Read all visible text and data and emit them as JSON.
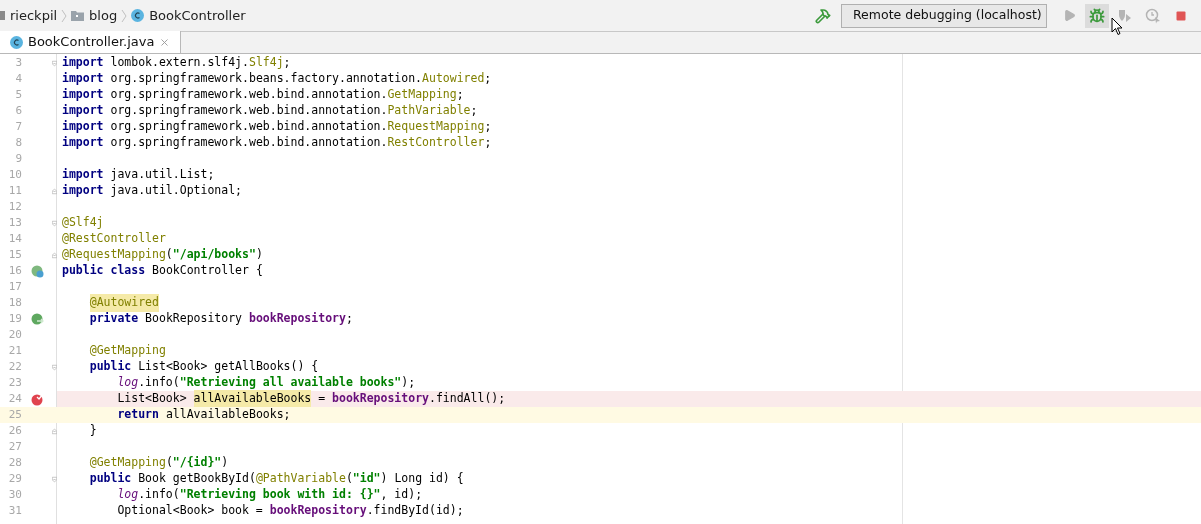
{
  "breadcrumbs": [
    {
      "label": "rieckpil",
      "kind": "module"
    },
    {
      "label": "blog",
      "kind": "folder"
    },
    {
      "label": "BookController",
      "kind": "class"
    }
  ],
  "toolbar": {
    "run_config": "Remote debugging (localhost)",
    "buttons": [
      {
        "kind": "run",
        "disabled": true,
        "hovered": false
      },
      {
        "kind": "debug",
        "disabled": false,
        "hovered": true
      },
      {
        "kind": "coverage",
        "disabled": true,
        "hovered": false
      },
      {
        "kind": "profile",
        "disabled": true,
        "hovered": false
      },
      {
        "kind": "stop",
        "disabled": false,
        "hovered": false
      }
    ]
  },
  "tabs": [
    {
      "label": "BookController.java",
      "selected": true
    }
  ],
  "lines": [
    {
      "n": "3",
      "fold": {
        "kind": "start"
      },
      "tokens": [
        {
          "kind": "kw",
          "text": "import"
        },
        {
          "kind": "plain",
          "text": " lombok.extern.slf4j."
        },
        {
          "kind": "ann",
          "text": "Slf4j"
        },
        {
          "kind": "plain",
          "text": ";"
        }
      ]
    },
    {
      "n": "4",
      "tokens": [
        {
          "kind": "kw",
          "text": "import"
        },
        {
          "kind": "plain",
          "text": " org.springframework.beans.factory.annotation."
        },
        {
          "kind": "ann",
          "text": "Autowired"
        },
        {
          "kind": "plain",
          "text": ";"
        }
      ]
    },
    {
      "n": "5",
      "tokens": [
        {
          "kind": "kw",
          "text": "import"
        },
        {
          "kind": "plain",
          "text": " org.springframework.web.bind.annotation."
        },
        {
          "kind": "ann",
          "text": "GetMapping"
        },
        {
          "kind": "plain",
          "text": ";"
        }
      ]
    },
    {
      "n": "6",
      "tokens": [
        {
          "kind": "kw",
          "text": "import"
        },
        {
          "kind": "plain",
          "text": " org.springframework.web.bind.annotation."
        },
        {
          "kind": "ann",
          "text": "PathVariable"
        },
        {
          "kind": "plain",
          "text": ";"
        }
      ]
    },
    {
      "n": "7",
      "tokens": [
        {
          "kind": "kw",
          "text": "import"
        },
        {
          "kind": "plain",
          "text": " org.springframework.web.bind.annotation."
        },
        {
          "kind": "ann",
          "text": "RequestMapping"
        },
        {
          "kind": "plain",
          "text": ";"
        }
      ]
    },
    {
      "n": "8",
      "tokens": [
        {
          "kind": "kw",
          "text": "import"
        },
        {
          "kind": "plain",
          "text": " org.springframework.web.bind.annotation."
        },
        {
          "kind": "ann",
          "text": "RestController"
        },
        {
          "kind": "plain",
          "text": ";"
        }
      ]
    },
    {
      "n": "9"
    },
    {
      "n": "10",
      "tokens": [
        {
          "kind": "kw",
          "text": "import"
        },
        {
          "kind": "plain",
          "text": " java.util.List;"
        }
      ]
    },
    {
      "n": "11",
      "fold": {
        "kind": "end"
      },
      "tokens": [
        {
          "kind": "kw",
          "text": "import"
        },
        {
          "kind": "plain",
          "text": " java.util.Optional;"
        }
      ]
    },
    {
      "n": "12"
    },
    {
      "n": "13",
      "fold": {
        "kind": "start"
      },
      "tokens": [
        {
          "kind": "ann",
          "text": "@Slf4j"
        }
      ]
    },
    {
      "n": "14",
      "tokens": [
        {
          "kind": "ann",
          "text": "@RestController"
        }
      ]
    },
    {
      "n": "15",
      "fold": {
        "kind": "end"
      },
      "tokens": [
        {
          "kind": "ann",
          "text": "@RequestMapping"
        },
        {
          "kind": "plain",
          "text": "("
        },
        {
          "kind": "str",
          "text": "\"/api/books\""
        },
        {
          "kind": "plain",
          "text": ")"
        }
      ]
    },
    {
      "n": "16",
      "gutter_icon": {
        "kind": "bean"
      },
      "tokens": [
        {
          "kind": "kw",
          "text": "public class"
        },
        {
          "kind": "plain",
          "text": " BookController {"
        }
      ]
    },
    {
      "n": "17"
    },
    {
      "n": "18",
      "tokens": [
        {
          "kind": "annhl",
          "text": "    @Autowired"
        }
      ]
    },
    {
      "n": "19",
      "gutter_icon": {
        "kind": "autowired"
      },
      "tokens": [
        {
          "kind": "kw",
          "text": "    private"
        },
        {
          "kind": "plain",
          "text": " BookRepository "
        },
        {
          "kind": "field",
          "text": "bookRepository"
        },
        {
          "kind": "plain",
          "text": ";"
        }
      ]
    },
    {
      "n": "20"
    },
    {
      "n": "21",
      "tokens": [
        {
          "kind": "ann",
          "text": "    @GetMapping"
        }
      ]
    },
    {
      "n": "22",
      "fold": {
        "kind": "start"
      },
      "tokens": [
        {
          "kind": "kw",
          "text": "    public"
        },
        {
          "kind": "plain",
          "text": " List<Book> getAllBooks() {"
        }
      ]
    },
    {
      "n": "23",
      "tokens": [
        {
          "kind": "log",
          "text": "        log"
        },
        {
          "kind": "plain",
          "text": ".info("
        },
        {
          "kind": "str",
          "text": "\"Retrieving all available books\""
        },
        {
          "kind": "plain",
          "text": ");"
        }
      ]
    },
    {
      "n": "24",
      "breakpoint": true,
      "current": false,
      "tokens": [
        {
          "kind": "plain",
          "text": "        List<Book> "
        },
        {
          "kind": "usage",
          "text": "allAvailableBooks"
        },
        {
          "kind": "plain",
          "text": " = "
        },
        {
          "kind": "field",
          "text": "bookRepository"
        },
        {
          "kind": "plain",
          "text": ".findAll();"
        }
      ]
    },
    {
      "n": "25",
      "breakpoint": false,
      "current": true,
      "tokens": [
        {
          "kind": "kw",
          "text": "        return"
        },
        {
          "kind": "plain",
          "text": " allAvailableBooks;"
        }
      ]
    },
    {
      "n": "26",
      "fold": {
        "kind": "end"
      },
      "tokens": [
        {
          "kind": "plain",
          "text": "    }"
        }
      ]
    },
    {
      "n": "27"
    },
    {
      "n": "28",
      "tokens": [
        {
          "kind": "ann",
          "text": "    @GetMapping"
        },
        {
          "kind": "plain",
          "text": "("
        },
        {
          "kind": "str",
          "text": "\"/{id}\""
        },
        {
          "kind": "plain",
          "text": ")"
        }
      ]
    },
    {
      "n": "29",
      "fold": {
        "kind": "start"
      },
      "tokens": [
        {
          "kind": "kw",
          "text": "    public"
        },
        {
          "kind": "plain",
          "text": " Book getBookById("
        },
        {
          "kind": "ann",
          "text": "@PathVariable"
        },
        {
          "kind": "plain",
          "text": "("
        },
        {
          "kind": "str",
          "text": "\"id\""
        },
        {
          "kind": "plain",
          "text": ") Long id) {"
        }
      ]
    },
    {
      "n": "30",
      "tokens": [
        {
          "kind": "log",
          "text": "        log"
        },
        {
          "kind": "plain",
          "text": ".info("
        },
        {
          "kind": "str",
          "text": "\"Retrieving book with id: {}\""
        },
        {
          "kind": "plain",
          "text": ", id);"
        }
      ]
    },
    {
      "n": "31",
      "tokens": [
        {
          "kind": "plain",
          "text": "        Optional<Book> book = "
        },
        {
          "kind": "field",
          "text": "bookRepository"
        },
        {
          "kind": "plain",
          "text": ".findById(id);"
        }
      ]
    }
  ]
}
